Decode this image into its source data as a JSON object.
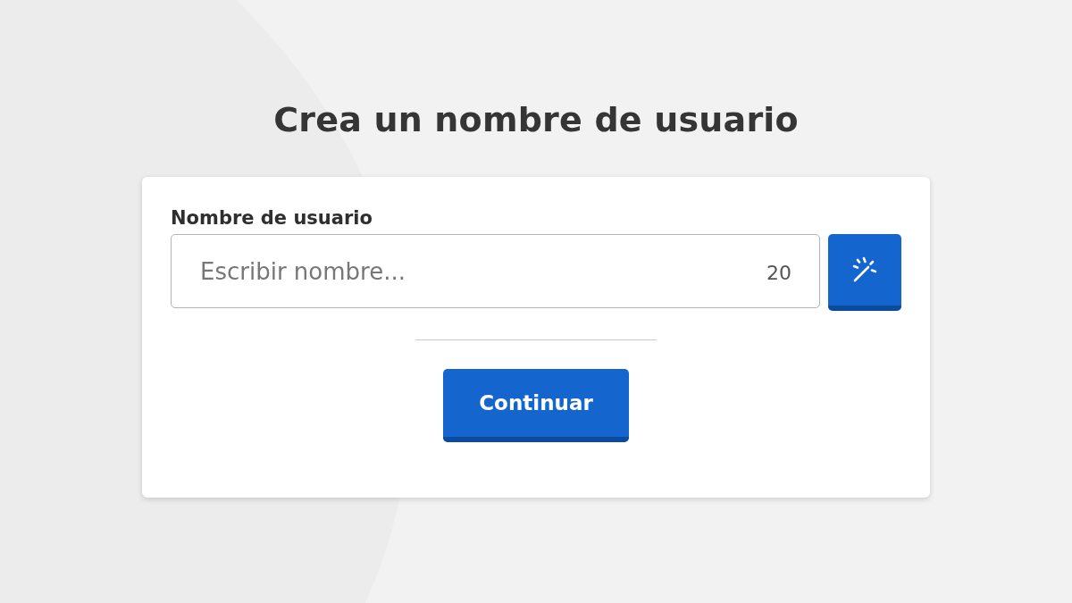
{
  "title": "Crea un nombre de usuario",
  "username_field": {
    "label": "Nombre de usuario",
    "placeholder": "Escribir nombre...",
    "counter": "20"
  },
  "continue_button": {
    "label": "Continuar"
  }
}
